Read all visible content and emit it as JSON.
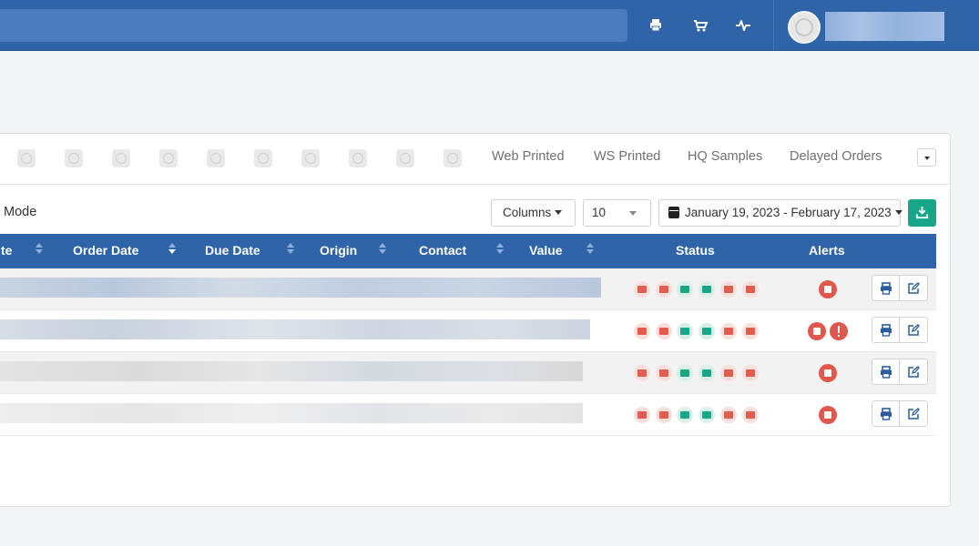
{
  "topbar": {
    "icons": [
      "print-icon",
      "cart-icon",
      "activity-icon"
    ],
    "accent": "#2f64a8"
  },
  "tabs": {
    "items": [
      {
        "label": "Web Printed"
      },
      {
        "label": "WS Printed"
      },
      {
        "label": "HQ Samples"
      },
      {
        "label": "Delayed Orders"
      }
    ]
  },
  "toolbar": {
    "mode_label": "Mode",
    "columns_label": "Columns",
    "page_size": "10",
    "date_range": "January 19, 2023 - February 17, 2023"
  },
  "table": {
    "headers": {
      "partial": "te",
      "order_date": "Order Date",
      "due_date": "Due Date",
      "origin": "Origin",
      "contact": "Contact",
      "value": "Value",
      "status": "Status",
      "alerts": "Alerts"
    },
    "status_icons": [
      "card-icon",
      "money-icon",
      "warehouse-icon",
      "printer-icon",
      "box-icon",
      "truck-icon"
    ],
    "rows": [
      {
        "alerts": [
          "stop-icon"
        ]
      },
      {
        "alerts": [
          "stop-icon",
          "exclamation-icon"
        ]
      },
      {
        "alerts": [
          "stop-icon"
        ]
      },
      {
        "alerts": [
          "stop-icon"
        ]
      }
    ]
  },
  "colors": {
    "header_blue": "#2f64a8",
    "success_green": "#18a689",
    "danger_red": "#e0584b"
  }
}
